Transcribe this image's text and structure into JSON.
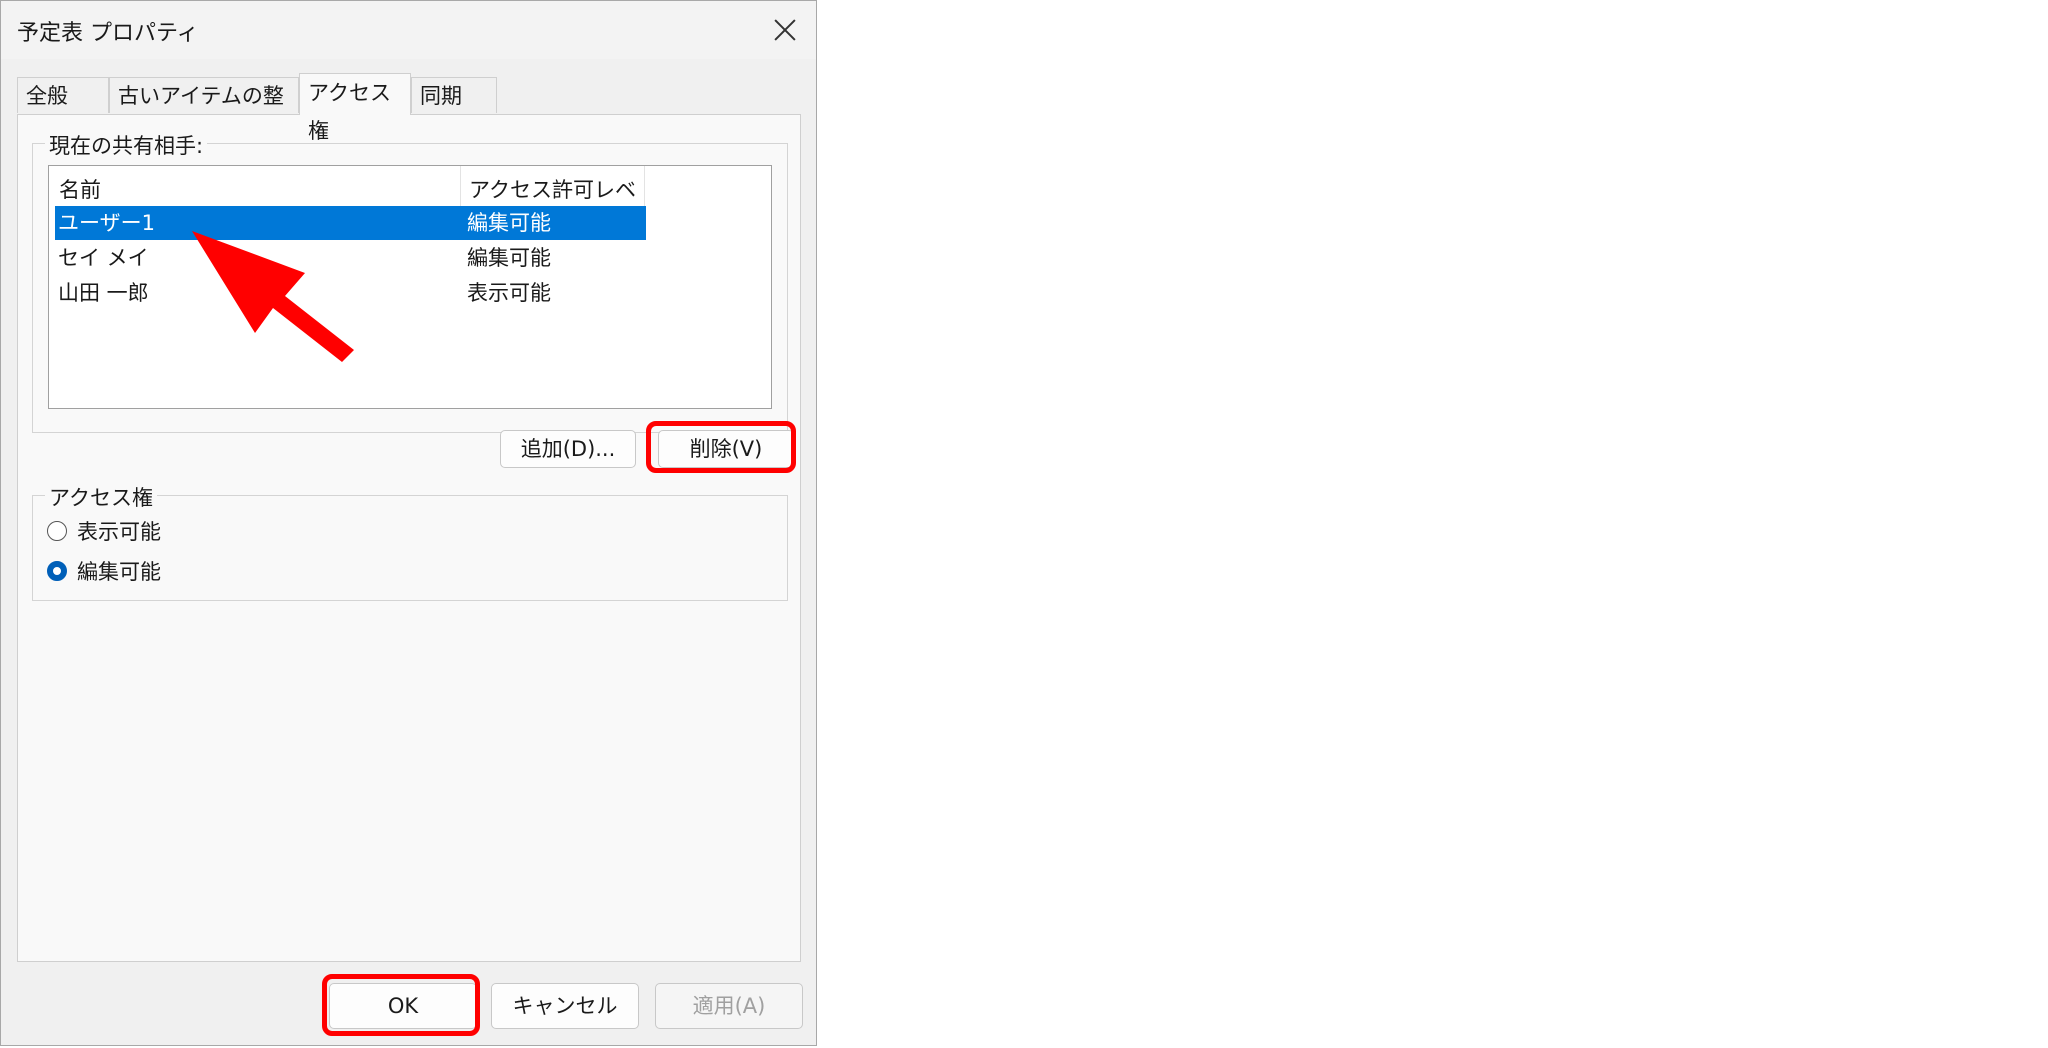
{
  "dialog": {
    "title": "予定表 プロパティ",
    "tabs": [
      {
        "label": "全般"
      },
      {
        "label": "古いアイテムの整理"
      },
      {
        "label": "アクセス権"
      },
      {
        "label": "同期"
      }
    ]
  },
  "sharing": {
    "group_label": "現在の共有相手:",
    "columns": [
      "名前",
      "アクセス許可レベル"
    ],
    "rows": [
      {
        "name": "ユーザー1",
        "level": "編集可能"
      },
      {
        "name": "セイ メイ",
        "level": "編集可能"
      },
      {
        "name": "山田 一郎",
        "level": "表示可能"
      }
    ],
    "add_label": "追加(D)...",
    "remove_label": "削除(V)"
  },
  "access": {
    "group_label": "アクセス権",
    "options": [
      {
        "label": "表示可能",
        "checked": false
      },
      {
        "label": "編集可能",
        "checked": true
      }
    ]
  },
  "footer": {
    "ok_label": "OK",
    "cancel_label": "キャンセル",
    "apply_label": "適用(A)"
  },
  "colors": {
    "selection": "#0078d7",
    "annotation": "#ff0000",
    "radio_checked": "#005fb8"
  },
  "icons": {
    "close": "close-icon",
    "annotation_arrow": "arrow-icon"
  }
}
